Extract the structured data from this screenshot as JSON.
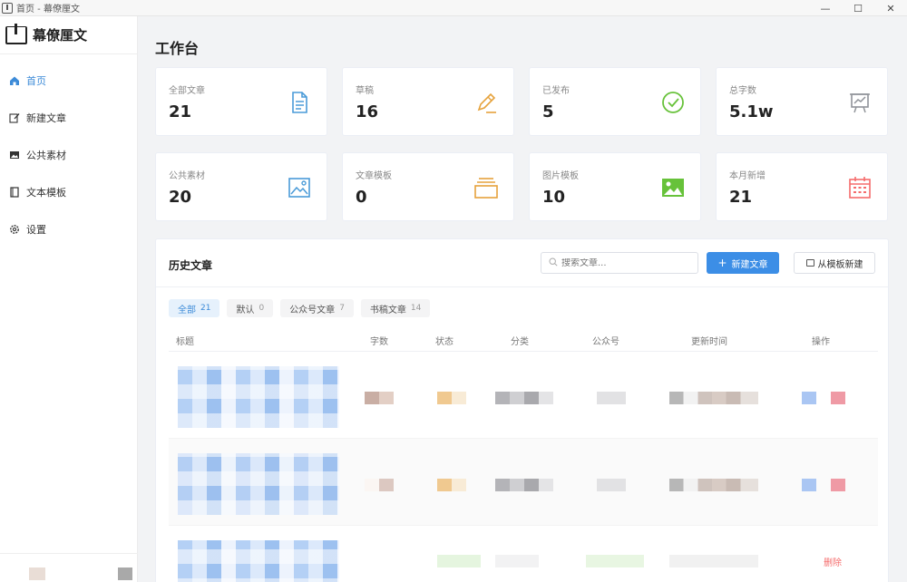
{
  "window": {
    "title": "首页 - 幕僚厘文",
    "minimize": "—",
    "maximize": "☐",
    "close": "✕"
  },
  "sidebar": {
    "brand": "幕僚厘文",
    "items": [
      {
        "label": "首页",
        "icon": "home-icon",
        "active": true
      },
      {
        "label": "新建文章",
        "icon": "edit-icon",
        "active": false
      },
      {
        "label": "公共素材",
        "icon": "image-icon",
        "active": false
      },
      {
        "label": "文本模板",
        "icon": "book-icon",
        "active": false
      },
      {
        "label": "设置",
        "icon": "gear-icon",
        "active": false
      }
    ]
  },
  "main": {
    "title": "工作台",
    "stats": [
      {
        "label": "全部文章",
        "value": "21",
        "icon": "document-icon",
        "color": "#4a9bd8"
      },
      {
        "label": "草稿",
        "value": "16",
        "icon": "pencil-icon",
        "color": "#e6a23c"
      },
      {
        "label": "已发布",
        "value": "5",
        "icon": "check-circle-icon",
        "color": "#67c23a"
      },
      {
        "label": "总字数",
        "value": "5.1w",
        "icon": "presentation-chart-icon",
        "color": "#909399"
      },
      {
        "label": "公共素材",
        "value": "20",
        "icon": "picture-outline-icon",
        "color": "#4a9bd8"
      },
      {
        "label": "文章模板",
        "value": "0",
        "icon": "layers-icon",
        "color": "#e6a23c"
      },
      {
        "label": "图片模板",
        "value": "10",
        "icon": "picture-filled-icon",
        "color": "#67c23a"
      },
      {
        "label": "本月新增",
        "value": "21",
        "icon": "calendar-icon",
        "color": "#f56c6c"
      }
    ]
  },
  "history": {
    "title": "历史文章",
    "search_placeholder": "搜索文章...",
    "new_button": "新建文章",
    "new_button_plus": "+",
    "template_button": "从模板新建",
    "filters": [
      {
        "label": "全部",
        "count": "21",
        "active": true
      },
      {
        "label": "默认",
        "count": "0",
        "active": false
      },
      {
        "label": "公众号文章",
        "count": "7",
        "active": false
      },
      {
        "label": "书稿文章",
        "count": "14",
        "active": false
      }
    ],
    "columns": [
      "标题",
      "字数",
      "状态",
      "分类",
      "公众号",
      "更新时间",
      "操作"
    ],
    "delete_label": "删除"
  },
  "colors": {
    "accent": "#3c8ee6",
    "danger": "#f56c6c"
  }
}
